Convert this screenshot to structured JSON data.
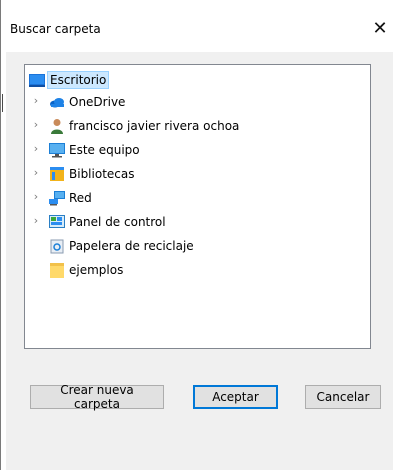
{
  "dialog": {
    "title": "Buscar carpeta",
    "close_glyph": "✕"
  },
  "tree": {
    "items": [
      {
        "label": "Escritorio",
        "icon": "desktop-icon",
        "expandable": false,
        "selected": true
      },
      {
        "label": "OneDrive",
        "icon": "onedrive-cloud-icon",
        "expandable": true
      },
      {
        "label": "francisco javier rivera ochoa",
        "icon": "user-icon",
        "expandable": true
      },
      {
        "label": "Este equipo",
        "icon": "computer-icon",
        "expandable": true
      },
      {
        "label": "Bibliotecas",
        "icon": "libraries-icon",
        "expandable": true
      },
      {
        "label": "Red",
        "icon": "network-icon",
        "expandable": true
      },
      {
        "label": "Panel de control",
        "icon": "control-panel-icon",
        "expandable": true
      },
      {
        "label": "Papelera de reciclaje",
        "icon": "recycle-bin-icon",
        "expandable": false
      },
      {
        "label": "ejemplos",
        "icon": "folder-icon",
        "expandable": false
      }
    ]
  },
  "buttons": {
    "new_folder": "Crear nueva carpeta",
    "ok": "Aceptar",
    "cancel": "Cancelar"
  },
  "colors": {
    "selection_bg": "#cce8ff",
    "accent": "#0078d7",
    "dialog_bg": "#f0f0f0"
  }
}
